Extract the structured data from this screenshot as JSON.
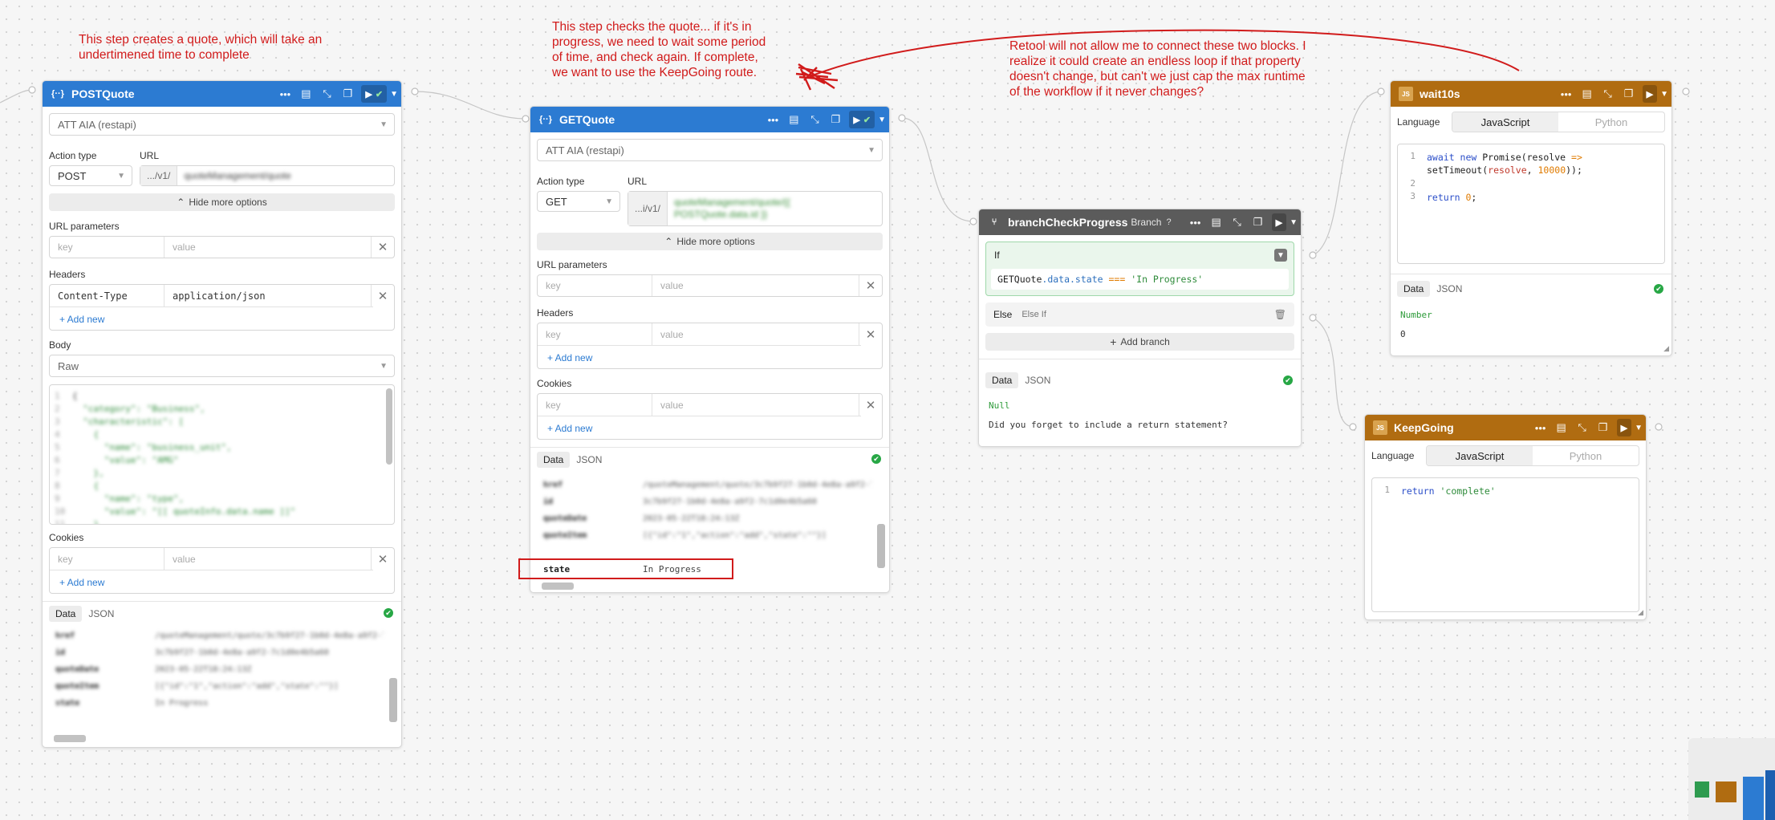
{
  "notes": {
    "post": "This step creates a quote, which will take an undertimened time to complete",
    "get": "This step checks the quote... if it's in progress, we need to wait some period of time, and check again. If complete, we want to use the KeepGoing route.",
    "retool": "Retool will not allow me to connect these two blocks. I realize it could create an endless loop if that property doesn't change, but can't we just cap the max runtime of the workflow if it never changes?"
  },
  "post_quote": {
    "title": "POSTQuote",
    "resource": "ATT AIA (restapi)",
    "action_type_label": "Action type",
    "url_label": "URL",
    "method": "POST",
    "url_prefix": ".../v1/",
    "url_path": "quoteManagement/quote",
    "hide_more": "Hide more options",
    "url_params_label": "URL parameters",
    "key_placeholder": "key",
    "value_placeholder": "value",
    "headers_label": "Headers",
    "header_key": "Content-Type",
    "header_value": "application/json",
    "add_new": "+ Add new",
    "body_label": "Body",
    "body_type": "Raw",
    "body_lines": [
      "{",
      "  \"category\": \"Business\",",
      "  \"characteristic\": [",
      "    {",
      "      \"name\": \"business_unit\",",
      "      \"value\": \"AMG\"",
      "    },",
      "    {",
      "      \"name\": \"type\",",
      "      \"value\": \"[[ quoteInfo.data.name ]]\"",
      "    }"
    ],
    "cookies_label": "Cookies",
    "tab_data": "Data",
    "tab_json": "JSON",
    "result_rows": [
      {
        "k": "href",
        "v": "/quoteManagement/quote/3c7b9f27-1b0d-4e8a-a9f2-7c1d0e4b5a60"
      },
      {
        "k": "id",
        "v": "3c7b9f27-1b0d-4e8a-a9f2-7c1d0e4b5a60"
      },
      {
        "k": "quoteDate",
        "v": "2023-05-22T18:24:13Z"
      },
      {
        "k": "quoteItem",
        "v": "[{\"id\":\"1\",\"action\":\"add\",\"state\":\"\"}]"
      },
      {
        "k": "state",
        "v": "In Progress"
      }
    ]
  },
  "get_quote": {
    "title": "GETQuote",
    "resource": "ATT AIA (restapi)",
    "action_type_label": "Action type",
    "url_label": "URL",
    "method": "GET",
    "url_prefix": "...i/v1/",
    "url_path": "quoteManagement/quote/{{ POSTQuote.data.id }}",
    "hide_more": "Hide more options",
    "url_params_label": "URL parameters",
    "key_placeholder": "key",
    "value_placeholder": "value",
    "headers_label": "Headers",
    "cookies_label": "Cookies",
    "add_new": "+ Add new",
    "tab_data": "Data",
    "tab_json": "JSON",
    "result_rows": [
      {
        "k": "href",
        "v": "/quoteManagement/quote/3c7b9f27-1b0d-4e8a-a9f2-7c1d0e4b5a60"
      },
      {
        "k": "id",
        "v": "3c7b9f27-1b0d-4e8a-a9f2-7c1d0e4b5a60"
      },
      {
        "k": "quoteDate",
        "v": "2023-05-22T18:24:13Z"
      },
      {
        "k": "quoteItem",
        "v": "[{\"id\":\"1\",\"action\":\"add\",\"state\":\"\"}]"
      }
    ],
    "state_key": "state",
    "state_value": "In Progress"
  },
  "branch": {
    "title": "branchCheckProgress",
    "tag": "Branch",
    "if_label": "If",
    "cond_obj": "GETQuote",
    "cond_prop": ".data.state",
    "cond_op": "===",
    "cond_val": "'In Progress'",
    "else_label": "Else",
    "else_if_label": "Else If",
    "add_branch": "Add branch",
    "tab_data": "Data",
    "tab_json": "JSON",
    "result_type": "Null",
    "result_msg": "Did you forget to include a return statement?"
  },
  "wait": {
    "title": "wait10s",
    "language_label": "Language",
    "lang_js": "JavaScript",
    "lang_py": "Python",
    "line1": "1",
    "line2": "2",
    "line3": "3",
    "code_kw1": "await new",
    "code_fn": " Promise(resolve ",
    "code_arrow": "=>",
    "code_l1b": "setTimeout(",
    "code_l1c": "resolve",
    "code_l1d": ", ",
    "code_num": "10000",
    "code_l1e": "));",
    "code_ret": "return",
    "code_zero": "0",
    "code_semi": ";",
    "tab_data": "Data",
    "tab_json": "JSON",
    "result_type": "Number",
    "result_value": "0"
  },
  "keep": {
    "title": "KeepGoing",
    "language_label": "Language",
    "lang_js": "JavaScript",
    "lang_py": "Python",
    "line1": "1",
    "code_ret": "return",
    "code_str": "'complete'"
  },
  "colors": {
    "blue_header": "#2c7bd2",
    "gray_header": "#5b5b5b",
    "orange_header": "#b06c11",
    "annotation_red": "#d11b1b",
    "success_green": "#27a745"
  }
}
